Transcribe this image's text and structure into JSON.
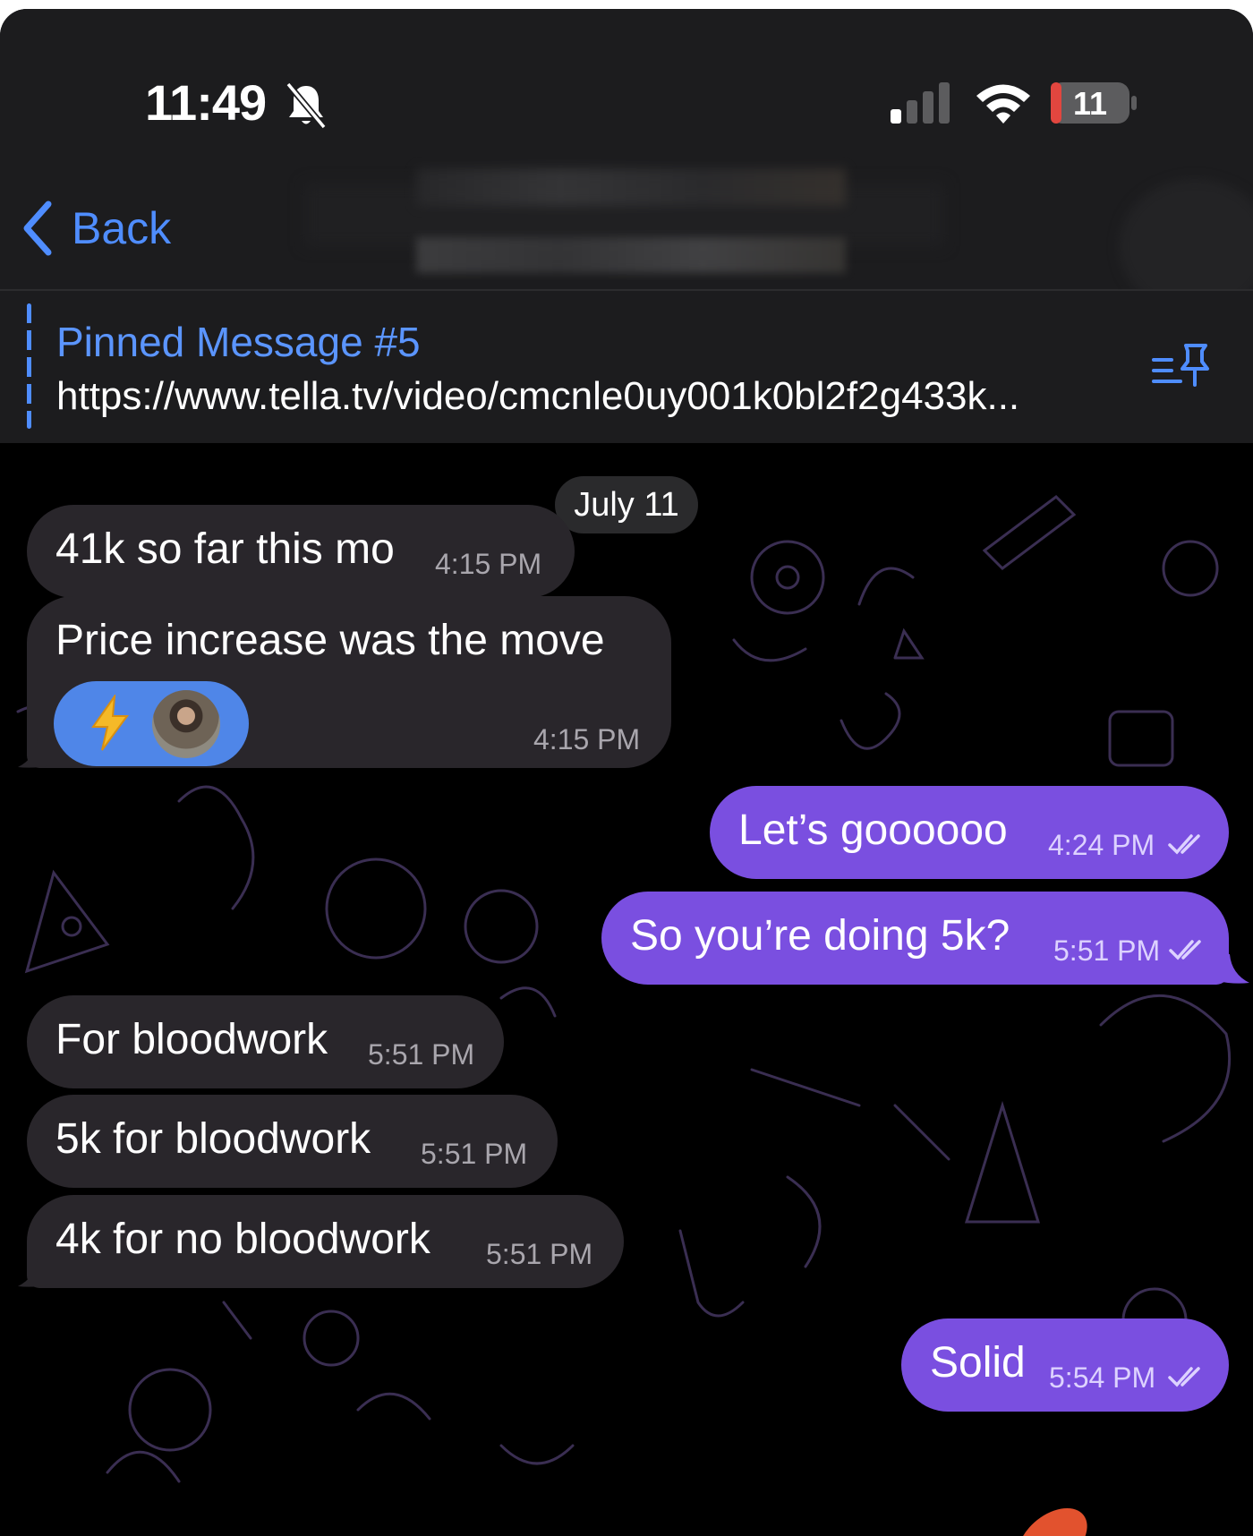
{
  "status_bar": {
    "time": "11:49",
    "battery": "11"
  },
  "nav": {
    "back_label": "Back"
  },
  "pinned": {
    "title": "Pinned Message #5",
    "url": "https://www.tella.tv/video/cmcnle0uy001k0bl2f2g433k..."
  },
  "chat": {
    "date_label": "July 11",
    "messages": [
      {
        "direction": "incoming",
        "text": "41k so far this mo",
        "time": "4:15 PM"
      },
      {
        "direction": "incoming",
        "text": "Price increase was the move",
        "time": "4:15 PM",
        "reaction": "⚡"
      },
      {
        "direction": "outgoing",
        "text": "Let’s goooooo",
        "time": "4:24 PM",
        "read": true
      },
      {
        "direction": "outgoing",
        "text": "So you’re doing 5k?",
        "time": "5:51 PM",
        "read": true
      },
      {
        "direction": "incoming",
        "text": "For bloodwork",
        "time": "5:51 PM"
      },
      {
        "direction": "incoming",
        "text": "5k for bloodwork",
        "time": "5:51 PM"
      },
      {
        "direction": "incoming",
        "text": "4k for no bloodwork",
        "time": "5:51 PM"
      },
      {
        "direction": "outgoing",
        "text": "Solid",
        "time": "5:54 PM",
        "read": true
      }
    ]
  },
  "colors": {
    "accent_blue": "#4f8dff",
    "outgoing_bubble": "#7a4fe0",
    "incoming_bubble": "#29262b",
    "header_bg": "#1c1c1e"
  },
  "icons": [
    "bell-slash-icon",
    "cellular-signal-icon",
    "wifi-icon",
    "battery-icon",
    "chevron-left-icon",
    "pinned-list-icon",
    "double-check-icon",
    "lightning-icon"
  ]
}
